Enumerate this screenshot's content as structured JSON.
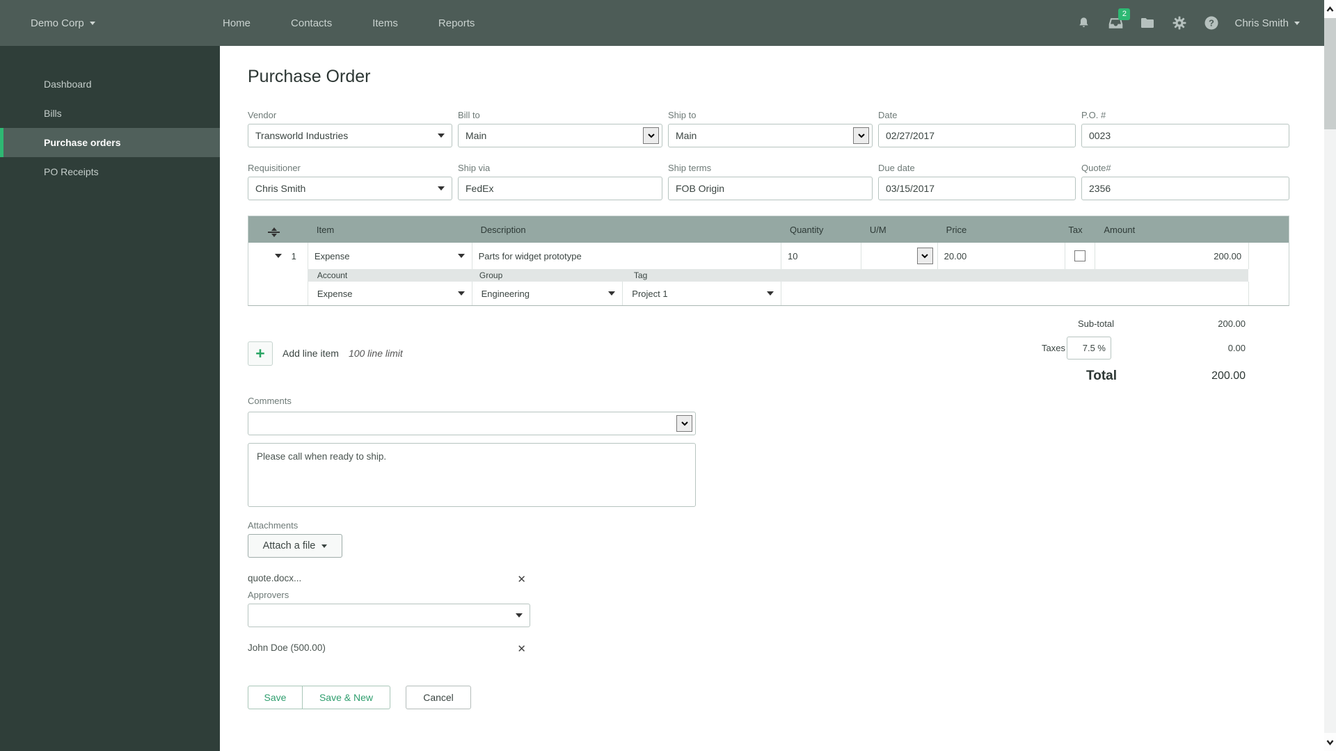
{
  "topnav": {
    "company": "Demo Corp",
    "links": [
      {
        "label": "Home"
      },
      {
        "label": "Contacts"
      },
      {
        "label": "Items"
      },
      {
        "label": "Reports"
      }
    ],
    "notifications_badge": "2",
    "user": "Chris Smith"
  },
  "sidebar": {
    "items": [
      {
        "label": "Dashboard"
      },
      {
        "label": "Bills"
      },
      {
        "label": "Purchase orders"
      },
      {
        "label": "PO Receipts"
      }
    ]
  },
  "page": {
    "title": "Purchase Order"
  },
  "form": {
    "vendor": {
      "label": "Vendor",
      "value": "Transworld Industries"
    },
    "bill_to": {
      "label": "Bill to",
      "value": "Main"
    },
    "ship_to": {
      "label": "Ship to",
      "value": "Main"
    },
    "date": {
      "label": "Date",
      "value": "02/27/2017"
    },
    "po_number": {
      "label": "P.O. #",
      "value": "0023"
    },
    "requisitioner": {
      "label": "Requisitioner",
      "value": "Chris Smith"
    },
    "ship_via": {
      "label": "Ship via",
      "value": "FedEx"
    },
    "ship_terms": {
      "label": "Ship terms",
      "value": "FOB Origin"
    },
    "due_date": {
      "label": "Due date",
      "value": "03/15/2017"
    },
    "quote_number": {
      "label": "Quote#",
      "value": "2356"
    }
  },
  "line_items": {
    "headers": {
      "item": "Item",
      "description": "Description",
      "quantity": "Quantity",
      "um": "U/M",
      "price": "Price",
      "tax": "Tax",
      "amount": "Amount"
    },
    "sub_headers": {
      "account": "Account",
      "group": "Group",
      "tag": "Tag"
    },
    "rows": [
      {
        "num": "1",
        "item": "Expense",
        "description": "Parts for widget prototype",
        "quantity": "10",
        "um": "",
        "price": "20.00",
        "tax_checked": false,
        "amount": "200.00",
        "account": "Expense",
        "group": "Engineering",
        "tag": "Project 1"
      }
    ],
    "add_button": "Add line item",
    "limit_note": "100 line limit"
  },
  "totals": {
    "sub_total_label": "Sub-total",
    "sub_total": "200.00",
    "taxes_label": "Taxes",
    "tax_rate": "7.5 %",
    "tax_value": "0.00",
    "total_label": "Total",
    "total_value": "200.00"
  },
  "comments": {
    "label": "Comments",
    "dropdown_value": "",
    "text": "Please call when ready to ship."
  },
  "attachments": {
    "label": "Attachments",
    "attach_button": "Attach a file",
    "files": [
      {
        "name": "quote.docx..."
      }
    ]
  },
  "approvers": {
    "label": "Approvers",
    "dropdown_value": "",
    "entries": [
      {
        "name": "John Doe (500.00)"
      }
    ]
  },
  "actions": {
    "save": "Save",
    "save_and_new": "Save & New",
    "cancel": "Cancel"
  },
  "colors": {
    "accent_green": "#2eb873",
    "topnav_bg": "#4d5c57",
    "sidebar_bg": "#2f3e39",
    "table_header_bg": "#95a8a3"
  }
}
